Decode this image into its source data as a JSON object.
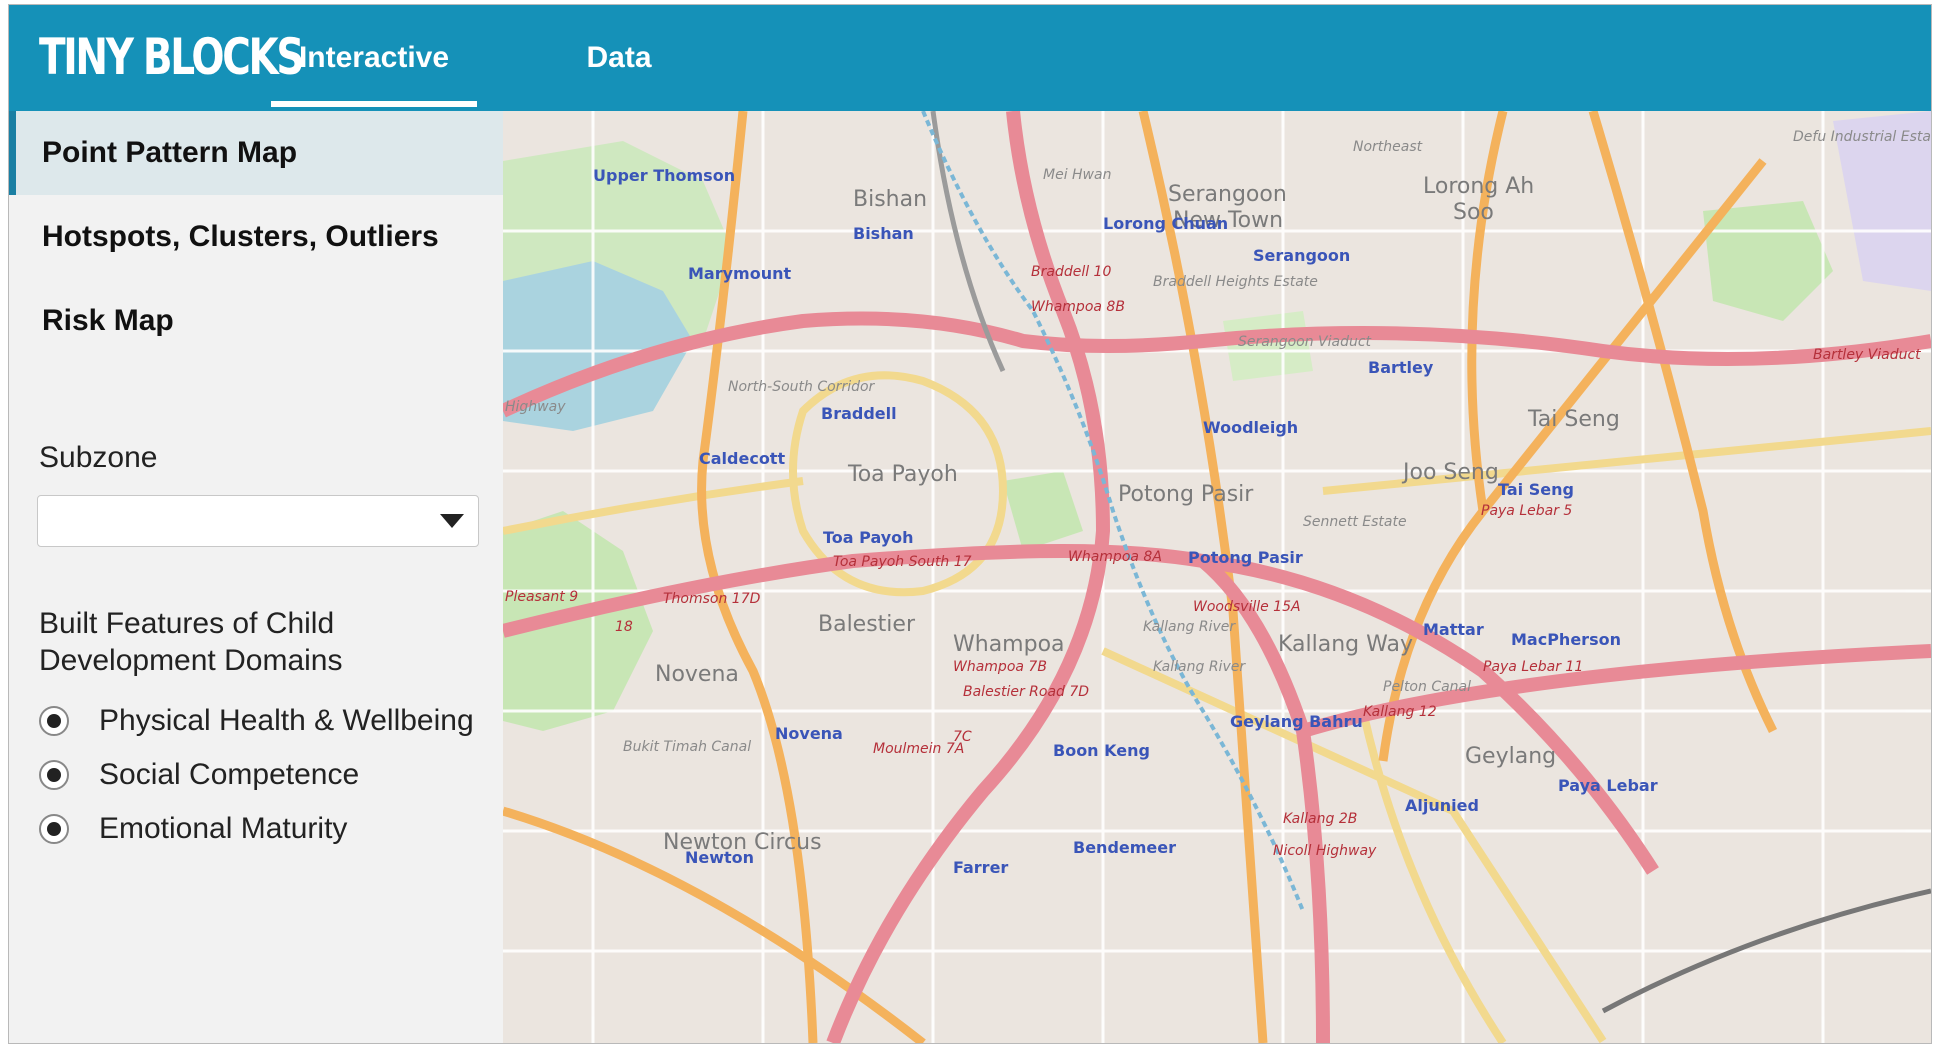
{
  "app": {
    "logo": "TINY BLOCKS",
    "nav": [
      {
        "label": "Interactive Maps",
        "active": true
      },
      {
        "label": "Data Explorer",
        "active": false
      }
    ],
    "accent_color": "#1591b8"
  },
  "sidebar": {
    "items": [
      {
        "label": "Point Pattern Map",
        "active": true
      },
      {
        "label": "Hotspots, Clusters, Outliers",
        "active": false
      },
      {
        "label": "Risk Map",
        "active": false
      }
    ],
    "subzone": {
      "label": "Subzone",
      "value": ""
    },
    "domains": {
      "label_line1": "Built Features of Child",
      "label_line2": "Development Domains",
      "options": [
        "Physical Health & Wellbeing",
        "Social Competence",
        "Emotional Maturity"
      ]
    }
  },
  "map": {
    "places": [
      "Bishan",
      "Serangoon",
      "New Town",
      "Lorong Ah",
      "Soo",
      "Toa Payoh",
      "Potong Pasir",
      "Joo Seng",
      "Tai Seng",
      "Balestier",
      "Whampoa",
      "Novena",
      "Kallang Way",
      "Geylang",
      "Newton Circus",
      "Mei Hwan",
      "Braddell Heights Estate",
      "Sennett Estate",
      "Defu Industrial Estate"
    ],
    "stations": [
      "Upper Thomson",
      "Bishan",
      "Marymount",
      "Lorong Chuan",
      "Serangoon",
      "Bartley",
      "Braddell",
      "Caldecott",
      "Woodleigh",
      "Toa Payoh",
      "Potong Pasir",
      "Tai Seng",
      "Mattar",
      "MacPherson",
      "Paya Lebar",
      "Geylang Bahru",
      "Boon Keng",
      "Novena",
      "Aljunied",
      "Bendemeer",
      "Farrer",
      "Newton"
    ],
    "road_labels": [
      "Braddell 10",
      "Whampoa 8B",
      "Toa Payoh South 17",
      "Whampoa 8A",
      "Woodsville 15A",
      "Thomson 17D",
      "Whampoa 7B",
      "Balestier Road 7D",
      "Moulmein 7A",
      "7C",
      "Paya Lebar 5",
      "Paya Lebar 11",
      "Kallang 12",
      "Kallang 2B",
      "Nicoll Highway",
      "18",
      "Pleasant 9",
      "Bartley Viaduct",
      "Kallang River",
      "Pelton Canal",
      "Bukit Timah Canal",
      "North-South Corridor",
      "Serangoon Viaduct",
      "Kallang River",
      "Highway",
      "Northeast"
    ]
  }
}
